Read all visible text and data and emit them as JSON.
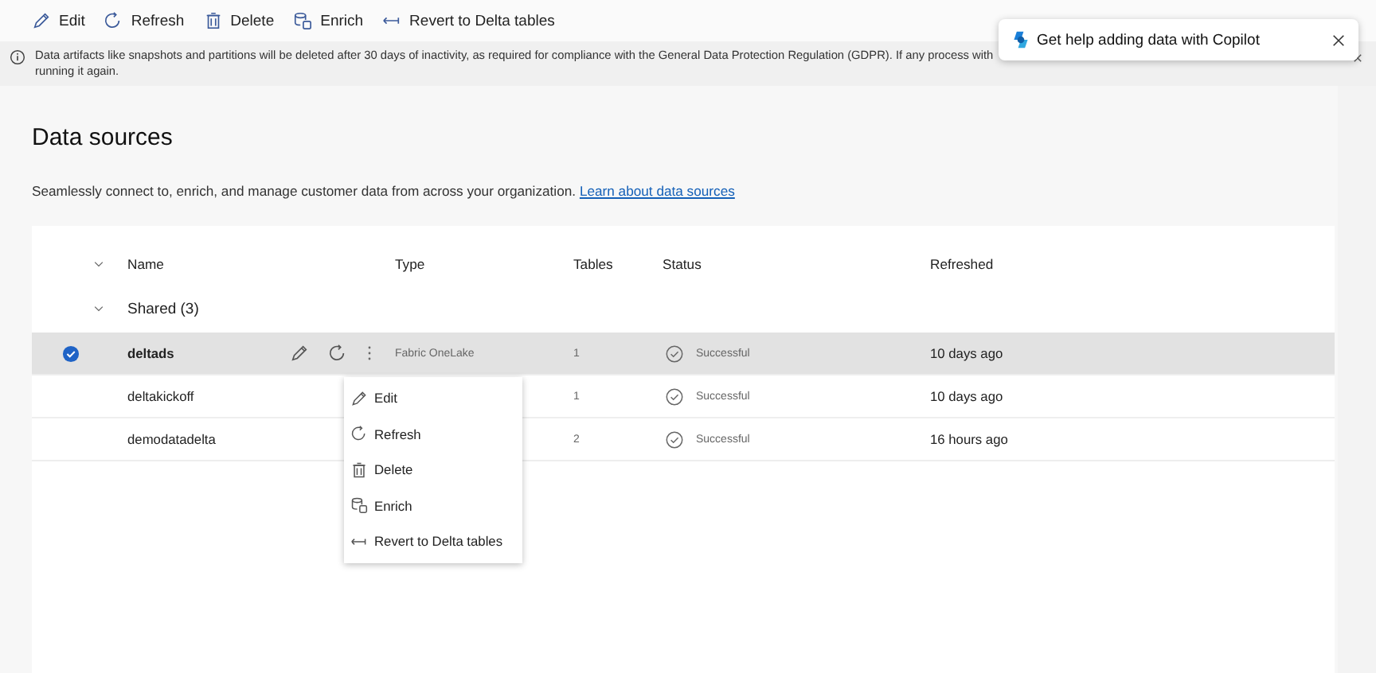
{
  "toolbar": [
    {
      "kind": "edit",
      "label": "Edit"
    },
    {
      "kind": "refresh",
      "label": "Refresh"
    },
    {
      "kind": "delete",
      "label": "Delete"
    },
    {
      "kind": "enrich",
      "label": "Enrich"
    },
    {
      "kind": "revert",
      "label": "Revert to Delta tables"
    }
  ],
  "banner": {
    "lines": [
      "Data artifacts like snapshots and partitions will be deleted after 30 days of inactivity, as required for compliance with the General Data Protection Regulation (GDPR). If any process with",
      "running it again."
    ]
  },
  "copilot_popup": {
    "text": "Get help adding data with Copilot"
  },
  "page": {
    "title": "Data sources",
    "description": "Seamlessly connect to, enrich, and manage customer data from across your organization.",
    "link": "Learn about data sources"
  },
  "table": {
    "columns": [
      "Name",
      "Type",
      "Tables",
      "Status",
      "Refreshed"
    ],
    "group": {
      "label": "Shared (3)",
      "expanded": true
    },
    "rows": [
      {
        "name": "deltads",
        "type": "Fabric OneLake",
        "tables": "1",
        "status": "Successful",
        "refreshed": "10 days ago",
        "selected": true
      },
      {
        "name": "deltakickoff",
        "tables": "1",
        "status": "Successful",
        "refreshed": "10 days ago",
        "selected": false
      },
      {
        "name": "demodatadelta",
        "tables": "2",
        "status": "Successful",
        "refreshed": "16 hours ago",
        "selected": false
      }
    ]
  },
  "context_menu": [
    {
      "kind": "edit",
      "label": "Edit"
    },
    {
      "kind": "refresh",
      "label": "Refresh"
    },
    {
      "kind": "delete",
      "label": "Delete"
    },
    {
      "kind": "enrich",
      "label": "Enrich"
    },
    {
      "kind": "revert",
      "label": "Revert to Delta tables"
    }
  ]
}
